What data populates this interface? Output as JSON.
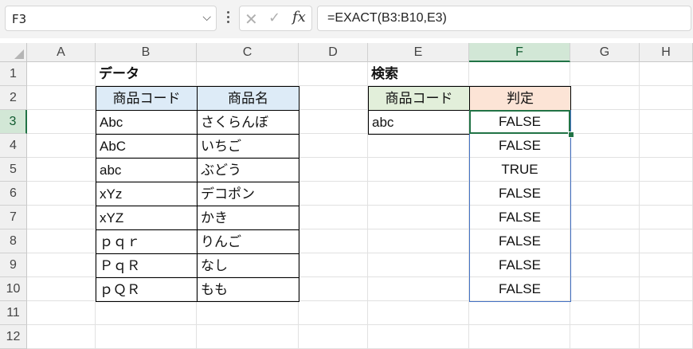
{
  "formula_bar": {
    "name_box": "F3",
    "cancel_glyph": "✕",
    "enter_glyph": "✓",
    "fx_label": "fx",
    "formula": "=EXACT(B3:B10,E3)"
  },
  "columns": [
    "A",
    "B",
    "C",
    "D",
    "E",
    "F",
    "G",
    "H"
  ],
  "rows": [
    "1",
    "2",
    "3",
    "4",
    "5",
    "6",
    "7",
    "8",
    "9",
    "10",
    "11",
    "12"
  ],
  "selected_cell": {
    "column": "F",
    "row": "3"
  },
  "sheet": {
    "data_title": "データ",
    "search_title": "検索",
    "data_table": {
      "headers": [
        "商品コード",
        "商品名"
      ],
      "rows": [
        [
          "Abc",
          "さくらんぼ"
        ],
        [
          "AbC",
          "いちご"
        ],
        [
          "abc",
          "ぶどう"
        ],
        [
          "xYz",
          "デコポン"
        ],
        [
          "xYZ",
          "かき"
        ],
        [
          "ｐｑｒ",
          "りんご"
        ],
        [
          "ＰｑＲ",
          "なし"
        ],
        [
          "ｐＱＲ",
          "もも"
        ]
      ]
    },
    "search_table": {
      "headers": [
        "商品コード",
        "判定"
      ],
      "search_value": "abc"
    },
    "results": [
      "FALSE",
      "FALSE",
      "TRUE",
      "FALSE",
      "FALSE",
      "FALSE",
      "FALSE",
      "FALSE"
    ]
  },
  "colors": {
    "header_blue": "#ddebf7",
    "header_green": "#e2efda",
    "header_orange": "#fce4d6",
    "selection_green": "#217346",
    "spill_border_blue": "#4472c4"
  }
}
